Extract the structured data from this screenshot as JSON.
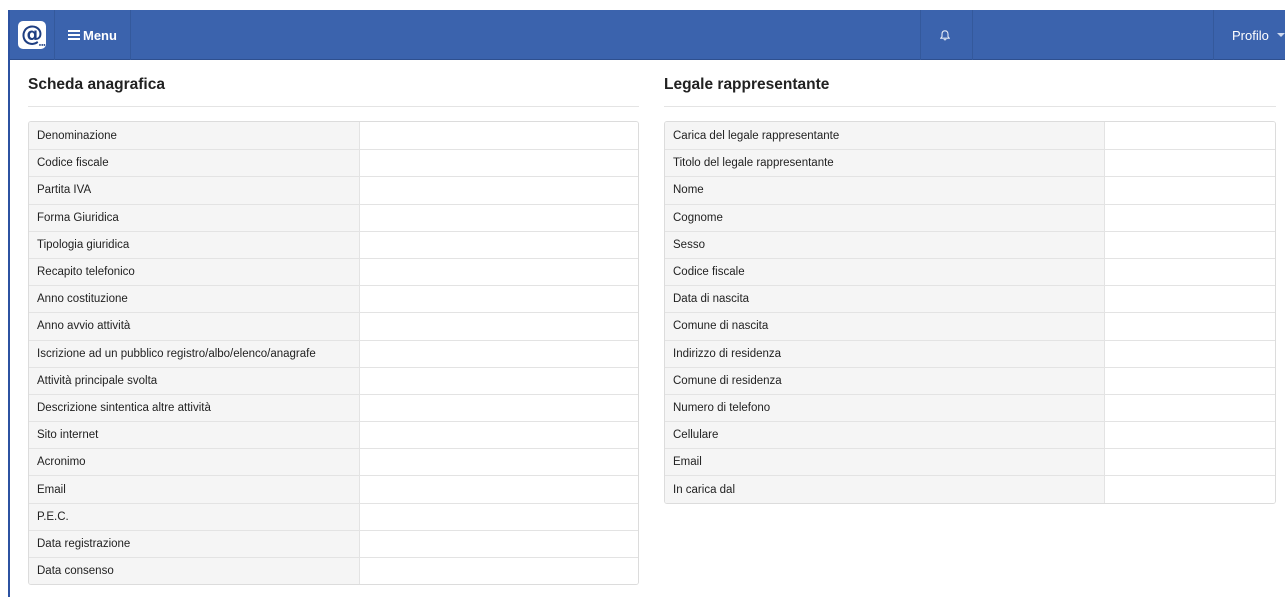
{
  "navbar": {
    "logo_text": "@",
    "menu_label": "Menu",
    "profile_label": "Profilo",
    "brand_color": "#3b63ad"
  },
  "icons": {
    "logo": "at-sign-logo-icon",
    "menu": "hamburger-menu-icon",
    "bell": "bell-icon",
    "caret": "caret-down-icon"
  },
  "scheda": {
    "title": "Scheda anagrafica",
    "rows": [
      {
        "label": "Denominazione",
        "value": ""
      },
      {
        "label": "Codice fiscale",
        "value": ""
      },
      {
        "label": "Partita IVA",
        "value": ""
      },
      {
        "label": "Forma Giuridica",
        "value": ""
      },
      {
        "label": "Tipologia giuridica",
        "value": ""
      },
      {
        "label": "Recapito telefonico",
        "value": ""
      },
      {
        "label": "Anno costituzione",
        "value": ""
      },
      {
        "label": "Anno avvio attività",
        "value": ""
      },
      {
        "label": "Iscrizione ad un pubblico registro/albo/elenco/anagrafe",
        "value": ""
      },
      {
        "label": "Attività principale svolta",
        "value": ""
      },
      {
        "label": "Descrizione sintentica altre attività",
        "value": ""
      },
      {
        "label": "Sito internet",
        "value": ""
      },
      {
        "label": "Acronimo",
        "value": ""
      },
      {
        "label": "Email",
        "value": ""
      },
      {
        "label": "P.E.C.",
        "value": ""
      },
      {
        "label": "Data registrazione",
        "value": ""
      },
      {
        "label": "Data consenso",
        "value": ""
      }
    ]
  },
  "legale": {
    "title": "Legale rappresentante",
    "rows": [
      {
        "label": "Carica del legale rappresentante",
        "value": ""
      },
      {
        "label": "Titolo del legale rappresentante",
        "value": ""
      },
      {
        "label": "Nome",
        "value": ""
      },
      {
        "label": "Cognome",
        "value": ""
      },
      {
        "label": "Sesso",
        "value": ""
      },
      {
        "label": "Codice fiscale",
        "value": ""
      },
      {
        "label": "Data di nascita",
        "value": ""
      },
      {
        "label": "Comune di nascita",
        "value": ""
      },
      {
        "label": "Indirizzo di residenza",
        "value": ""
      },
      {
        "label": "Comune di residenza",
        "value": ""
      },
      {
        "label": "Numero di telefono",
        "value": ""
      },
      {
        "label": "Cellulare",
        "value": ""
      },
      {
        "label": "Email",
        "value": ""
      },
      {
        "label": "In carica dal",
        "value": ""
      }
    ]
  }
}
